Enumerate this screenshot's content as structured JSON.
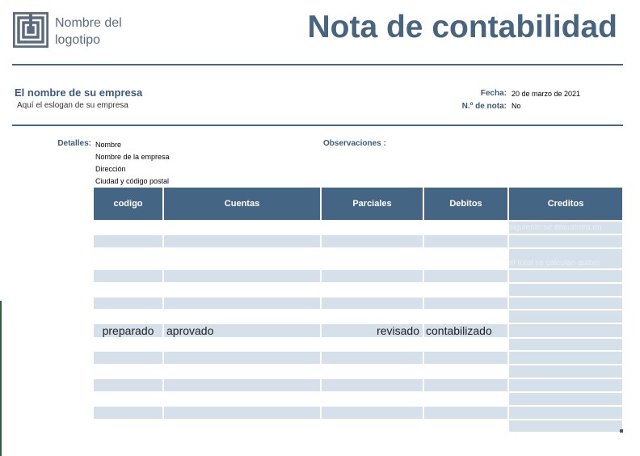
{
  "header": {
    "logo_text": "Nombre del logotipo",
    "title": "Nota de contabilidad"
  },
  "company": {
    "name": "El nombre de su empresa",
    "slogan": "Aquí el eslogan de su empresa"
  },
  "meta": {
    "date_label": "Fecha:",
    "date_value": "20 de marzo de 2021",
    "note_label": "N.º de nota:",
    "note_value": "No"
  },
  "details": {
    "label": "Detalles:",
    "lines": [
      "Nombre",
      "Nombre de la empresa",
      "Dirección",
      "Ciudad y código postal"
    ],
    "observations_label": "Observaciones :"
  },
  "table": {
    "columns": [
      "codigo",
      "Cuentas",
      "Parciales",
      "Debitos",
      "Creditos"
    ],
    "overflow_text_1": "siguiente se encuentra en",
    "overflow_text_2": "el total se calculan autom",
    "summary": {
      "prepared": "preparado",
      "approved": "aprovado",
      "reviewed": "revisado",
      "posted": "contabilizado"
    }
  },
  "colors": {
    "accent": "#456584",
    "band": "#d6e0ea",
    "title": "#486580"
  }
}
